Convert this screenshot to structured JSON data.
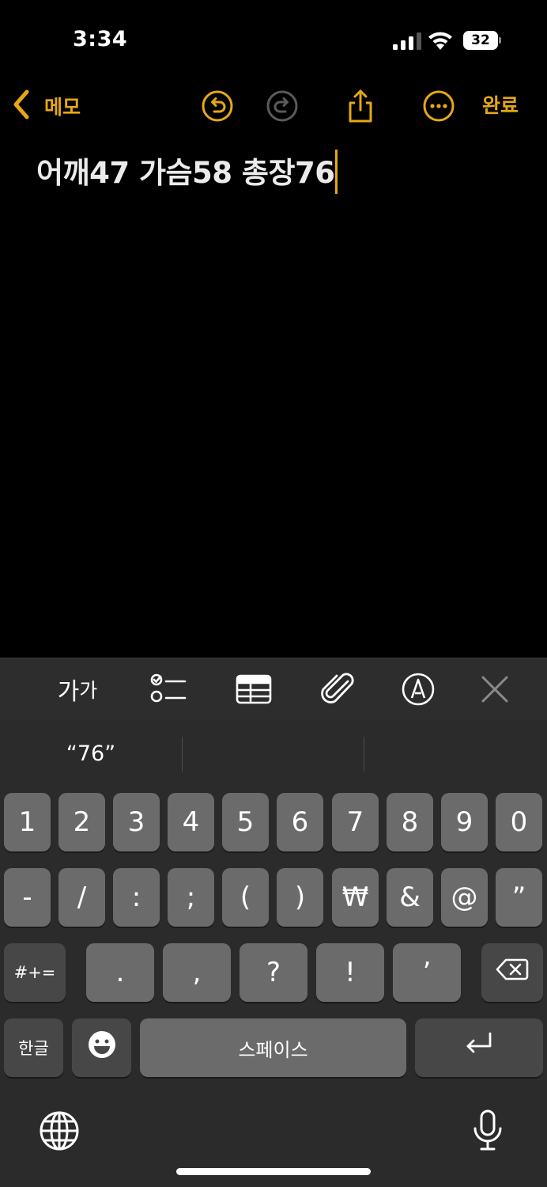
{
  "status_bar": {
    "time": "3:34",
    "battery_level": "32",
    "signal_bars": 3,
    "signal_max": 4
  },
  "nav": {
    "back_label": "메모",
    "done_label": "완료",
    "icons": [
      "undo-icon",
      "redo-icon",
      "share-icon",
      "more-icon"
    ],
    "accent_color": "#e5a814"
  },
  "note": {
    "text": "어깨47 가슴58 총장76"
  },
  "format_toolbar": {
    "text_style_label_large": "가",
    "text_style_label_small": "가",
    "icons": [
      "text-format-icon",
      "checklist-icon",
      "table-icon",
      "attachment-icon",
      "markup-icon",
      "close-icon"
    ]
  },
  "keyboard": {
    "suggestions": [
      "“76”",
      "",
      ""
    ],
    "row1": [
      "1",
      "2",
      "3",
      "4",
      "5",
      "6",
      "7",
      "8",
      "9",
      "0"
    ],
    "row2": [
      "-",
      "/",
      ":",
      ";",
      "(",
      ")",
      "₩",
      "&",
      "@",
      "”"
    ],
    "row3_mode": "#+=",
    "row3": [
      ".",
      ",",
      "?",
      "!",
      "’"
    ],
    "lang_key": "한글",
    "space_label": "스페이스",
    "icons": [
      "delete-icon",
      "emoji-icon",
      "return-icon",
      "globe-icon",
      "microphone-icon"
    ]
  }
}
